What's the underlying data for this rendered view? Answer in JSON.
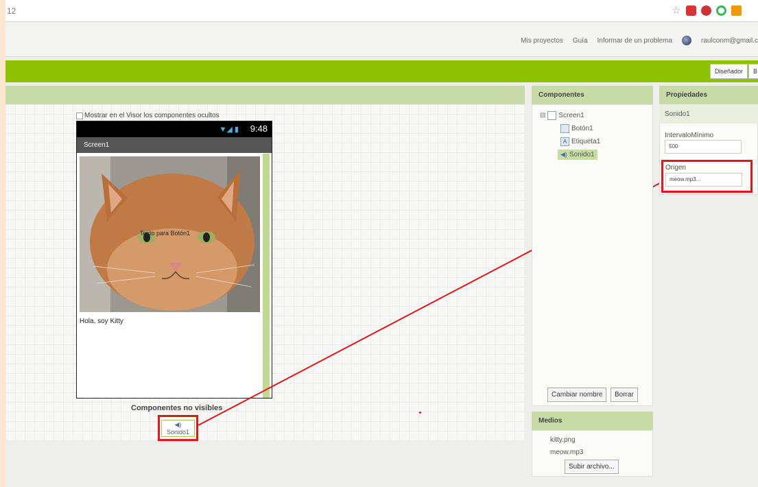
{
  "browser": {
    "url_fragment": "12"
  },
  "header": {
    "links": [
      "Mis proyectos",
      "Guía",
      "Informar de un problema"
    ],
    "account": "raulconm@gmail.c"
  },
  "toolbar": {
    "designer_label": "Diseñador",
    "blocks_label": "B"
  },
  "viewer": {
    "show_hidden_label": "Mostrar en el Visor los componentes ocultos",
    "status_time": "9:48",
    "screen_title": "Screen1",
    "button_text": "Texto para Botón1",
    "label_text": "Hola, soy Kitty",
    "nonvisible_title": "Componentes no visibles",
    "nonvisible_item": "Sonido1"
  },
  "components": {
    "title": "Componentes",
    "root": "Screen1",
    "children": [
      "Botón1",
      "Etiqueta1",
      "Sonido1"
    ],
    "rename_label": "Cambiar nombre",
    "delete_label": "Borrar"
  },
  "media": {
    "title": "Medios",
    "files": [
      "kitty.png",
      "meow.mp3"
    ],
    "upload_label": "Subir archivo..."
  },
  "properties": {
    "title": "Propiedades",
    "component": "Sonido1",
    "min_interval_label": "IntervaloMínimo",
    "min_interval_value": "500",
    "source_label": "Origen",
    "source_value": "meow.mp3..."
  },
  "colors": {
    "accent_green": "#8ec100",
    "highlight_red": "#e21818"
  }
}
